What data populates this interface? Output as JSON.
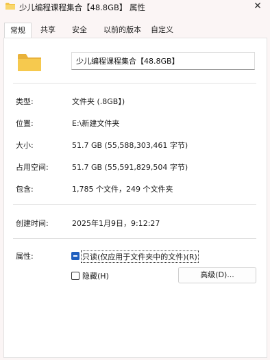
{
  "window": {
    "title": "少儿编程课程集合【48.8GB】 属性",
    "close_glyph": "✕"
  },
  "tabs": [
    {
      "label": "常规",
      "active": true
    },
    {
      "label": "共享",
      "active": false
    },
    {
      "label": "安全",
      "active": false
    },
    {
      "label": "以前的版本",
      "active": false
    },
    {
      "label": "自定义",
      "active": false
    }
  ],
  "general": {
    "folder_icon": "folder-icon",
    "name": "少儿编程课程集合【48.8GB】",
    "fields": [
      {
        "label": "类型:",
        "value": "文件夹 (.8GB】)"
      },
      {
        "label": "位置:",
        "value": "E:\\新建文件夹"
      },
      {
        "label": "大小:",
        "value": "51.7 GB (55,588,303,461 字节)"
      },
      {
        "label": "占用空间:",
        "value": "51.7 GB (55,591,829,504 字节)"
      },
      {
        "label": "包含:",
        "value": "1,785 个文件，249 个文件夹"
      }
    ],
    "created": {
      "label": "创建时间:",
      "value": "2025年1月9日，9:12:27"
    },
    "attributes": {
      "label": "属性:",
      "readonly": {
        "label": "只读(仅应用于文件夹中的文件)(R)",
        "checked": true
      },
      "hidden": {
        "label": "隐藏(H)",
        "checked": false
      },
      "advanced_button": "高级(D)..."
    }
  },
  "colors": {
    "accent": "#1f5fbf",
    "folder": "#f4c548",
    "background": "#fbf5f5"
  }
}
